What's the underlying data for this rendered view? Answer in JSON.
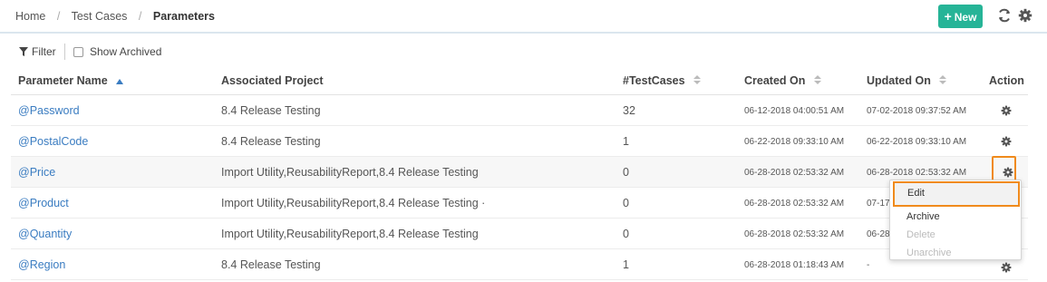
{
  "breadcrumb": {
    "home": "Home",
    "section": "Test Cases",
    "current": "Parameters"
  },
  "toolbar": {
    "new_label": "New",
    "new_color": "#26b497"
  },
  "filters": {
    "filter_label": "Filter",
    "show_archived_label": "Show Archived",
    "show_archived_checked": false
  },
  "table": {
    "headers": {
      "name": "Parameter Name",
      "project": "Associated Project",
      "testcases": "#TestCases",
      "created": "Created On",
      "updated": "Updated On",
      "action": "Action"
    },
    "rows": [
      {
        "name": "@Password",
        "project": "8.4 Release Testing",
        "testcases": "32",
        "created": "06-12-2018 04:00:51 AM",
        "updated": "07-02-2018 09:37:52 AM"
      },
      {
        "name": "@PostalCode",
        "project": "8.4 Release Testing",
        "testcases": "1",
        "created": "06-22-2018 09:33:10 AM",
        "updated": "06-22-2018 09:33:10 AM"
      },
      {
        "name": "@Price",
        "project": "Import Utility,ReusabilityReport,8.4 Release Testing",
        "testcases": "0",
        "created": "06-28-2018 02:53:32 AM",
        "updated": "06-28-2018 02:53:32 AM"
      },
      {
        "name": "@Product",
        "project": "Import Utility,ReusabilityReport,8.4 Release Testing ·",
        "testcases": "0",
        "created": "06-28-2018 02:53:32 AM",
        "updated": "07-17"
      },
      {
        "name": "@Quantity",
        "project": "Import Utility,ReusabilityReport,8.4 Release Testing",
        "testcases": "0",
        "created": "06-28-2018 02:53:32 AM",
        "updated": "06-28"
      },
      {
        "name": "@Region",
        "project": "8.4 Release Testing",
        "testcases": "1",
        "created": "06-28-2018 01:18:43 AM",
        "updated": "-"
      }
    ]
  },
  "action_menu": {
    "edit": "Edit",
    "archive": "Archive",
    "delete": "Delete",
    "unarchive": "Unarchive"
  },
  "colors": {
    "link": "#3a7cc1",
    "highlight": "#f08a1c",
    "accent": "#26b497"
  },
  "icons": {
    "refresh": "refresh-icon",
    "settings": "gear-icon",
    "filter": "filter-icon",
    "sort_asc": "sort-asc-icon",
    "sort_both": "sort-icon"
  }
}
